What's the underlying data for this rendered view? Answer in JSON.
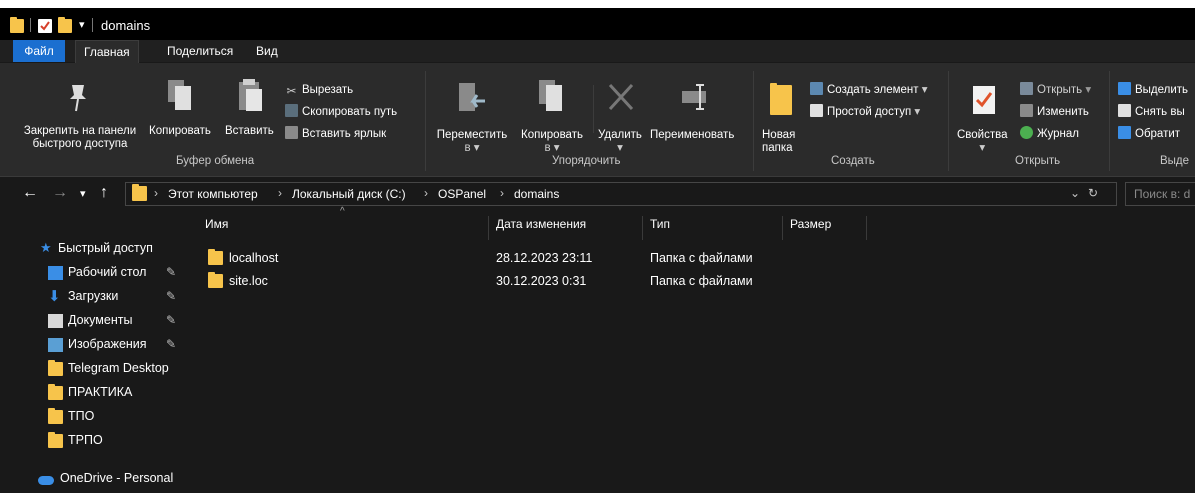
{
  "window": {
    "title": "domains"
  },
  "ribbon_tabs": [
    "Файл",
    "Главная",
    "Поделиться",
    "Вид"
  ],
  "ribbon": {
    "clipboard": {
      "pin_label_1": "Закрепить на панели",
      "pin_label_2": "быстрого доступа",
      "copy": "Копировать",
      "paste": "Вставить",
      "cut": "Вырезать",
      "copy_path": "Скопировать путь",
      "paste_shortcut": "Вставить ярлык",
      "group": "Буфер обмена"
    },
    "organize": {
      "move_1": "Переместить",
      "move_2": "в",
      "copy_1": "Копировать",
      "copy_2": "в",
      "delete": "Удалить",
      "rename": "Переименовать",
      "group": "Упорядочить"
    },
    "create": {
      "new_folder_1": "Новая",
      "new_folder_2": "папка",
      "new_item": "Создать элемент",
      "easy_access": "Простой доступ",
      "group": "Создать"
    },
    "open": {
      "properties": "Свойства",
      "open": "Открыть",
      "edit": "Изменить",
      "history": "Журнал",
      "group": "Открыть"
    },
    "select": {
      "select_all": "Выделить",
      "select_none": "Снять вы",
      "invert": "Обратит",
      "group": "Выде"
    }
  },
  "address": {
    "crumbs": [
      "Этот компьютер",
      "Локальный диск (C:)",
      "OSPanel",
      "domains"
    ],
    "search_placeholder": "Поиск в: d"
  },
  "nav": {
    "quick_access": "Быстрый доступ",
    "items": [
      {
        "label": "Рабочий стол",
        "icon": "desktop-icon",
        "pinned": true
      },
      {
        "label": "Загрузки",
        "icon": "download-icon",
        "pinned": true
      },
      {
        "label": "Документы",
        "icon": "document-icon",
        "pinned": true
      },
      {
        "label": "Изображения",
        "icon": "pictures-icon",
        "pinned": true
      },
      {
        "label": "Telegram Desktop",
        "icon": "folder-icon",
        "pinned": false
      },
      {
        "label": "ПРАКТИКА",
        "icon": "folder-icon",
        "pinned": false
      },
      {
        "label": "ТПО",
        "icon": "folder-icon",
        "pinned": false
      },
      {
        "label": "ТРПО",
        "icon": "folder-icon",
        "pinned": false
      }
    ],
    "onedrive": "OneDrive - Personal"
  },
  "columns": {
    "name": "Имя",
    "modified": "Дата изменения",
    "type": "Тип",
    "size": "Размер"
  },
  "files": [
    {
      "name": "localhost",
      "modified": "28.12.2023 23:11",
      "type": "Папка с файлами"
    },
    {
      "name": "site.loc",
      "modified": "30.12.2023 0:31",
      "type": "Папка с файлами"
    }
  ],
  "colors": {
    "accent": "#1b6fd0",
    "folder": "#f7c44b",
    "background": "#191919",
    "ribbon": "#2b2b2b"
  }
}
